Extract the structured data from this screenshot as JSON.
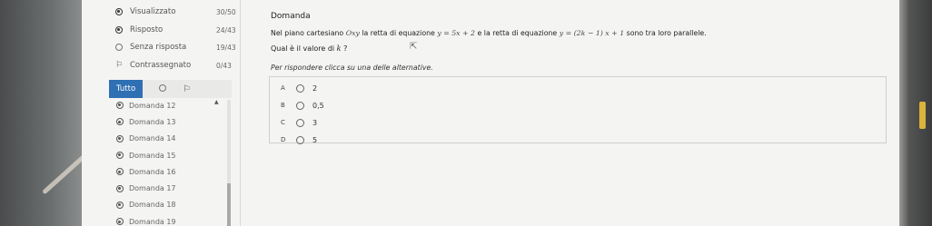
{
  "status_summary": [
    {
      "icon": "radio-filled-icon",
      "label": "Visualizzato",
      "count": "30/50"
    },
    {
      "icon": "radio-filled-icon",
      "label": "Risposto",
      "count": "24/43"
    },
    {
      "icon": "radio-empty-icon",
      "label": "Senza risposta",
      "count": "19/43"
    },
    {
      "icon": "flag-icon",
      "label": "Contrassegnato",
      "count": "0/43"
    }
  ],
  "filter": {
    "active_tab": "Tutto",
    "icons": [
      "radio-empty-icon",
      "flag-icon"
    ]
  },
  "question_list": [
    "Domanda 12",
    "Domanda 13",
    "Domanda 14",
    "Domanda 15",
    "Domanda 16",
    "Domanda 17",
    "Domanda 18",
    "Domanda 19"
  ],
  "question": {
    "title": "Domanda",
    "text_part1": "Nel piano cartesiano",
    "math_plane": "Oxy",
    "text_part2": "la retta di equazione",
    "math_eq1": "y = 5x + 2",
    "text_part3": "e la retta di equazione",
    "math_eq2": "y = (2k − 1) x + 1",
    "text_part4": "sono tra loro parallele.",
    "ask_prefix": "Qual è il valore di",
    "ask_var": "k",
    "ask_suffix": "?",
    "instruction": "Per rispondere clicca su una delle alternative."
  },
  "answers": [
    {
      "letter": "A",
      "value": "2"
    },
    {
      "letter": "B",
      "value": "0,5"
    },
    {
      "letter": "C",
      "value": "3"
    },
    {
      "letter": "D",
      "value": "5"
    }
  ]
}
